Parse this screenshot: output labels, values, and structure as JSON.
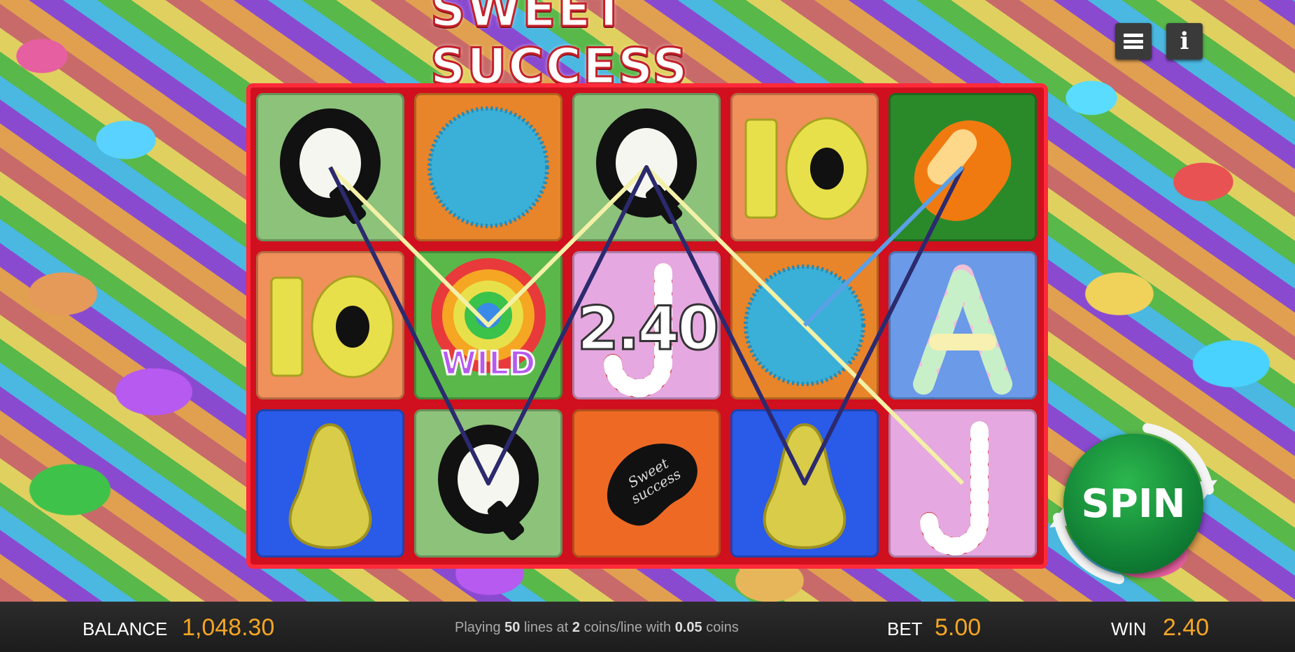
{
  "game": {
    "title": "SWEET SUCCESS",
    "win_popup": "2.40"
  },
  "controls": {
    "menu_icon": "hamburger-menu-icon",
    "info_icon": "info-icon",
    "info_label": "i",
    "spin_label": "SPIN"
  },
  "reels": [
    [
      "licorice-q",
      "10-orange",
      "pear-blue"
    ],
    [
      "blue-gumdrop",
      "wild-lollipop",
      "licorice-q"
    ],
    [
      "licorice-q",
      "candy-cane-j",
      "jellybean"
    ],
    [
      "10-orange",
      "blue-gumdrop",
      "pear-blue"
    ],
    [
      "orange-candy",
      "marshmallow-a",
      "candy-cane-j"
    ]
  ],
  "symbols": {
    "wild_text": "WILD",
    "jellybean_text_1": "Sweet",
    "jellybean_text_2": "success"
  },
  "win_lines": [
    {
      "color": "#f3f0a8",
      "path": [
        [
          0,
          0
        ],
        [
          1,
          1
        ],
        [
          2,
          0
        ],
        [
          3,
          1
        ],
        [
          4,
          2
        ]
      ]
    },
    {
      "color": "#2c2a6e",
      "path": [
        [
          0,
          0
        ],
        [
          1,
          2
        ],
        [
          2,
          0
        ],
        [
          3,
          2
        ],
        [
          4,
          0
        ]
      ]
    },
    {
      "color": "#5aa0e6",
      "path": [
        [
          3,
          1
        ],
        [
          4,
          0
        ]
      ]
    }
  ],
  "footer": {
    "balance_label": "BALANCE",
    "balance_value": "1,048.30",
    "lines_prefix": "Playing",
    "lines_count": "50",
    "lines_mid": "lines at",
    "coins_per_line": "2",
    "coins_mid": "coins/line with",
    "coin_value": "0.05",
    "coins_suffix": "coins",
    "bet_label": "BET",
    "bet_value": "5.00",
    "win_label": "WIN",
    "win_value": "2.40"
  },
  "colors": {
    "frame": "#d0101e",
    "accent": "#f5a623",
    "spin_green": "#0e7a32"
  }
}
